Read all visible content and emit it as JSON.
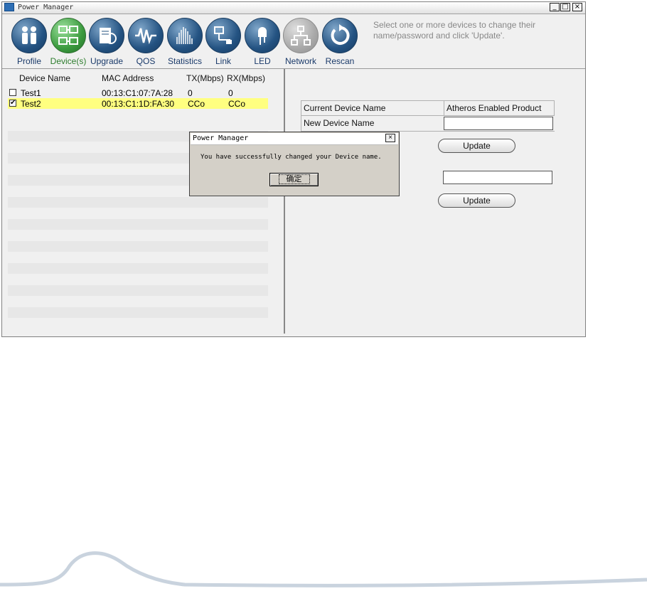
{
  "window": {
    "title": "Power Manager",
    "controls": [
      "_",
      "□",
      "×"
    ]
  },
  "toolbar": {
    "items": [
      {
        "label": "Profile",
        "icon": "people-icon"
      },
      {
        "label": "Device(s)",
        "icon": "network-devices-icon"
      },
      {
        "label": "Upgrade",
        "icon": "upgrade-icon"
      },
      {
        "label": "QOS",
        "icon": "waveform-icon"
      },
      {
        "label": "Statistics",
        "icon": "statistics-icon"
      },
      {
        "label": "Link",
        "icon": "link-icon"
      },
      {
        "label": "LED",
        "icon": "led-icon"
      },
      {
        "label": "Network",
        "icon": "network-icon"
      },
      {
        "label": "Rescan",
        "icon": "rescan-icon"
      }
    ],
    "active": "Device(s)",
    "hint": "Select one or more devices to change their name/password and click 'Update'."
  },
  "devices": {
    "headers": [
      "Device Name",
      "MAC Address",
      "TX(Mbps)",
      "RX(Mbps)"
    ],
    "rows": [
      {
        "name": "Test1",
        "mac": "00:13:C1:07:7A:28",
        "tx": "0",
        "rx": "0",
        "checked": false
      },
      {
        "name": "Test2",
        "mac": "00:13:C1:1D:FA:30",
        "tx": "CCo",
        "rx": "CCo",
        "checked": true
      }
    ],
    "selected_color": "#ffff80"
  },
  "properties": {
    "current_name_label": "Current Device Name",
    "current_name_value": "Atheros Enabled Product",
    "new_name_label": "New Device Name",
    "new_name_value": "",
    "password_value": "",
    "update_label": "Update",
    "update_label_2": "Update"
  },
  "dialog": {
    "title": "Power Manager",
    "message": "You have successfully changed your Device name.",
    "ok_label": "确定",
    "close_label": "×"
  },
  "colors": {
    "toolbar_icon": "#245382",
    "active_icon": "#3b9a3e",
    "disabled_icon": "#a9a9a9"
  }
}
